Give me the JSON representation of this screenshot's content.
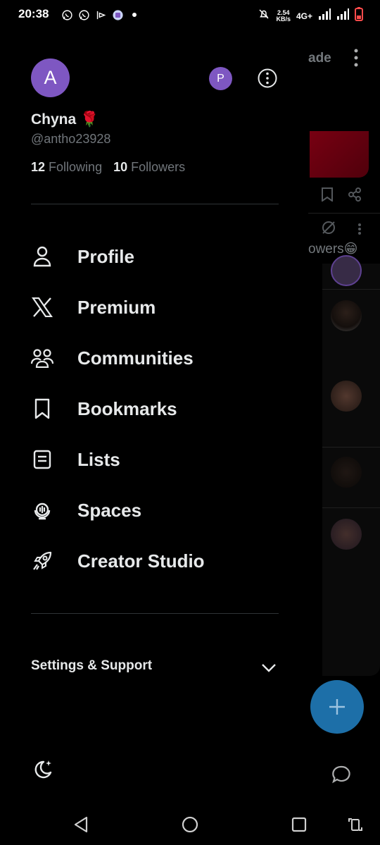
{
  "status_bar": {
    "time": "20:38",
    "net_speed_value": "2.54",
    "net_speed_unit": "KB/s",
    "network": "4G+",
    "icons": [
      "whatsapp-icon",
      "whatsapp-business-icon",
      "app-icon",
      "gallery-icon",
      "dot-icon",
      "mute-icon",
      "signal-icon",
      "signal-icon",
      "battery-low-icon"
    ]
  },
  "drawer": {
    "avatar_letter": "A",
    "switch_account_letter": "P",
    "display_name": "Chyna",
    "name_emoji": "🌹",
    "handle": "@antho23928",
    "following_count": "12",
    "following_label": "Following",
    "followers_count": "10",
    "followers_label": "Followers",
    "menu": [
      {
        "label": "Profile",
        "icon": "person-icon"
      },
      {
        "label": "Premium",
        "icon": "x-logo-icon"
      },
      {
        "label": "Communities",
        "icon": "communities-icon"
      },
      {
        "label": "Bookmarks",
        "icon": "bookmark-icon"
      },
      {
        "label": "Lists",
        "icon": "list-icon"
      },
      {
        "label": "Spaces",
        "icon": "spaces-icon"
      },
      {
        "label": "Creator Studio",
        "icon": "rocket-icon"
      }
    ],
    "settings_label": "Settings & Support"
  },
  "background": {
    "tab_fragment": "ade",
    "followers_fragment": "owers😁"
  },
  "colors": {
    "accent_purple": "#7e57c2",
    "fab_blue": "#1d6fa8",
    "text_primary": "#e7e9ea",
    "text_secondary": "#71767b",
    "divider": "#2f3336"
  }
}
